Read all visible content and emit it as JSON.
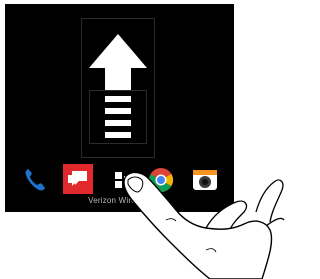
{
  "status": {
    "carrier": "Verizon Wireless"
  },
  "dock": {
    "apps": [
      {
        "name": "phone",
        "icon": "phone-icon",
        "color": "#1e73c8"
      },
      {
        "name": "messages",
        "icon": "messages-icon",
        "color": "#e0282d"
      },
      {
        "name": "app-drawer",
        "icon": "app-drawer-icon",
        "color": "#ffffff"
      },
      {
        "name": "chrome",
        "icon": "chrome-icon",
        "color": "#db4437"
      },
      {
        "name": "camera",
        "icon": "camera-icon",
        "color": "#f7941e"
      }
    ]
  },
  "gesture": {
    "type": "swipe-up",
    "direction": "up"
  },
  "colors": {
    "screen_background": "#000000",
    "arrow": "#ffffff",
    "hand_outline": "#000000",
    "hand_fill": "#ffffff"
  }
}
